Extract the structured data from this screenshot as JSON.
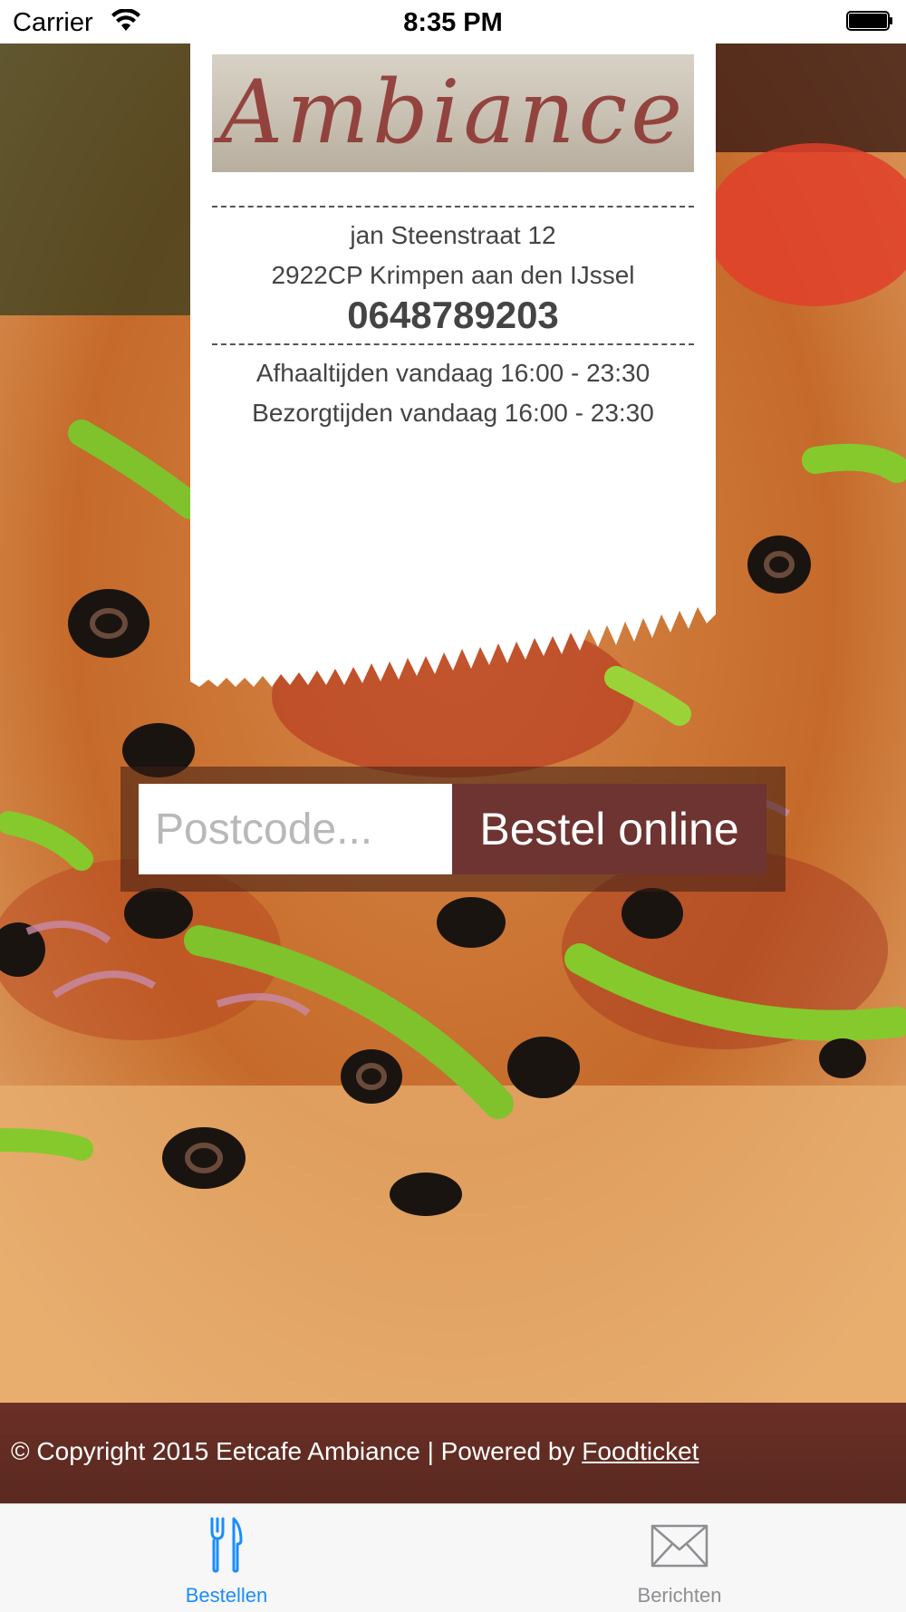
{
  "status_bar": {
    "carrier": "Carrier",
    "time": "8:35 PM"
  },
  "logo": {
    "text": "Ambiance"
  },
  "address": {
    "street": "jan Steenstraat 12",
    "city": "2922CP Krimpen aan den IJssel",
    "phone": "0648789203"
  },
  "hours": {
    "pickup": "Afhaaltijden vandaag 16:00 - 23:30",
    "delivery": "Bezorgtijden vandaag 16:00 - 23:30"
  },
  "order": {
    "postcode_placeholder": "Postcode...",
    "postcode_value": "",
    "button_label": "Bestel online"
  },
  "footer": {
    "text": "© Copyright 2015 Eetcafe Ambiance | Powered by ",
    "link_label": "Foodticket"
  },
  "tabs": [
    {
      "label": "Bestellen",
      "icon": "fork-knife-icon",
      "active": true
    },
    {
      "label": "Berichten",
      "icon": "envelope-icon",
      "active": false
    }
  ],
  "colors": {
    "accent_tab": "#1a8cff",
    "order_button": "#6e3432",
    "footer_bg": "#5a2920"
  }
}
